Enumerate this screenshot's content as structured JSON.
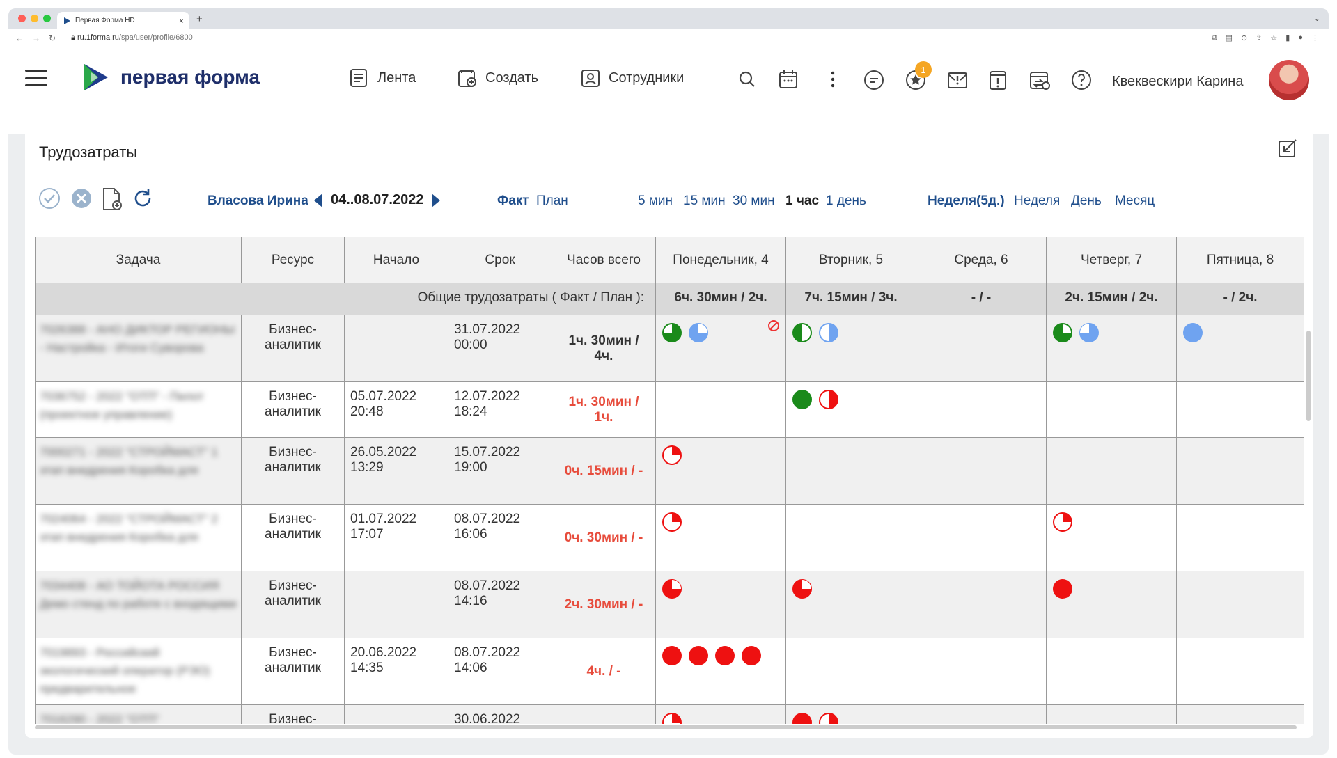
{
  "browser": {
    "tab_title": "Первая Форма HD",
    "url_domain": "ru.1forma.ru",
    "url_path": "/spa/user/profile/6800"
  },
  "header": {
    "logo_text": "первая форма",
    "nav": [
      {
        "label": "Лента",
        "icon": "feed-icon"
      },
      {
        "label": "Создать",
        "icon": "create-icon"
      },
      {
        "label": "Сотрудники",
        "icon": "employees-icon"
      }
    ],
    "notification_count": "1",
    "user_name": "Квеквескири Карина"
  },
  "panel": {
    "title": "Трудозатраты",
    "person": "Власова Ирина",
    "date_range": "04..08.07.2022",
    "modes": {
      "fact": "Факт",
      "plan": "План"
    },
    "scale": [
      "5 мин",
      "15 мин",
      "30 мин",
      "1 час",
      "1 день"
    ],
    "period": [
      "Неделя(5д.)",
      "Неделя",
      "День",
      "Месяц"
    ]
  },
  "table": {
    "headers": [
      "Задача",
      "Ресурс",
      "Начало",
      "Срок",
      "Часов всего",
      "Понедельник, 4",
      "Вторник, 5",
      "Среда, 6",
      "Четверг, 7",
      "Пятница, 8"
    ],
    "total_label": "Общие трудозатраты ( Факт / План ):",
    "totals": [
      "6ч. 30мин / 2ч.",
      "7ч. 15мин / 3ч.",
      "- / -",
      "2ч. 15мин / 2ч.",
      "- / 2ч."
    ],
    "rows": [
      {
        "task": "7026388 - АНО ДИКТОР РЕГИОНЫ - Настройка - Итоги Суворова",
        "resource": "Бизнес-аналитик",
        "start": "",
        "due": "31.07.2022 00:00",
        "hours": "1ч. 30мин / 4ч.",
        "hours_red": false
      },
      {
        "task": "7036752 - 2022 \"ОТП\" - Пилот (проектное управление)",
        "resource": "Бизнес-аналитик",
        "start": "05.07.2022 20:48",
        "due": "12.07.2022 18:24",
        "hours": "1ч. 30мин / 1ч.",
        "hours_red": true
      },
      {
        "task": "7000271 - 2022 \"СТРОЙМАСТ\" 1 этап внедрения Коробка для",
        "resource": "Бизнес-аналитик",
        "start": "26.05.2022 13:29",
        "due": "15.07.2022 19:00",
        "hours": "0ч. 15мин / -",
        "hours_red": true
      },
      {
        "task": "7024064 - 2022 \"СТРОЙМАСТ\" 2 этап внедрения Коробка для",
        "resource": "Бизнес-аналитик",
        "start": "01.07.2022 17:07",
        "due": "08.07.2022 16:06",
        "hours": "0ч. 30мин / -",
        "hours_red": true
      },
      {
        "task": "7034408 - АО ТОЙОТА РОССИЯ Демо стенд по работе с входящими",
        "resource": "Бизнес-аналитик",
        "start": "",
        "due": "08.07.2022 14:16",
        "hours": "2ч. 30мин / -",
        "hours_red": true
      },
      {
        "task": "7019893 - Российский экологический оператор (РЭО) предварительное",
        "resource": "Бизнес-аналитик",
        "start": "20.06.2022 14:35",
        "due": "08.07.2022 14:06",
        "hours": "4ч. / -",
        "hours_red": true
      },
      {
        "task": "7016290 - 2022 \"ОТП\"",
        "resource": "Бизнес-",
        "start": "",
        "due": "30.06.2022",
        "hours": "",
        "hours_red": false
      }
    ]
  },
  "colors": {
    "fact_green": "#1a8a1a",
    "plan_blue": "#6fa3f0",
    "overdue_red": "#ee1111",
    "link_blue": "#1f4e8c",
    "badge_orange": "#f5a623"
  }
}
